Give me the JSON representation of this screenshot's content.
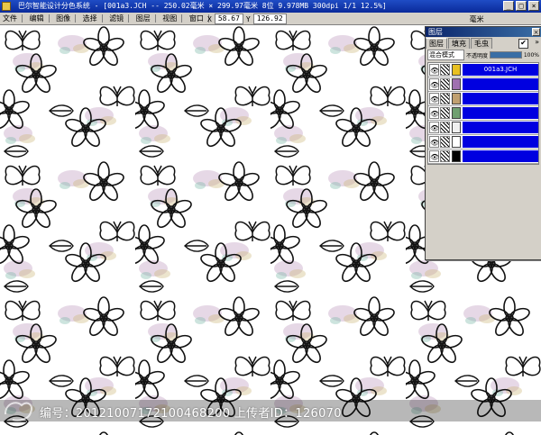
{
  "window": {
    "title": "巴尔智能设计分色系统 - [001a3.JCH -- 250.02毫米 × 299.97毫米 8位  9.978MB 300dpi 1/1  12.5%]",
    "buttons": [
      "_",
      "□",
      "×"
    ]
  },
  "menubar": {
    "items": [
      "文件",
      "编辑",
      "图像",
      "选择",
      "滤镜",
      "图层",
      "视图",
      "窗口",
      "帮助"
    ]
  },
  "coords": {
    "x_label": "X",
    "x_value": "58.67",
    "y_label": "Y",
    "y_value": "126.92",
    "unit": "毫米"
  },
  "panel": {
    "title": "图层",
    "tabs": [
      "图层",
      "填充",
      "毛虫"
    ],
    "active_tab": 0,
    "check": "✔",
    "menu": "»",
    "blend_mode": "混合模式",
    "opacity_label": "不透明度",
    "opacity_value": "100%",
    "opacity_level": 1.0,
    "layers": [
      {
        "name": "001a3.JCH",
        "swatch": "#e8c020",
        "visible": "👁"
      },
      {
        "name": "",
        "swatch": "#a070b0",
        "visible": "👁"
      },
      {
        "name": "",
        "swatch": "#c0a070",
        "visible": "👁"
      },
      {
        "name": "",
        "swatch": "#70a070",
        "visible": "👁"
      },
      {
        "name": "",
        "swatch": "#f0f0f0",
        "visible": "👁"
      },
      {
        "name": "",
        "swatch": "#ffffff",
        "visible": "👁"
      },
      {
        "name": "",
        "swatch": "#000000",
        "visible": "👁"
      }
    ]
  },
  "watermark": {
    "text": "编号：20121007172100468200 上传者ID：126070"
  }
}
